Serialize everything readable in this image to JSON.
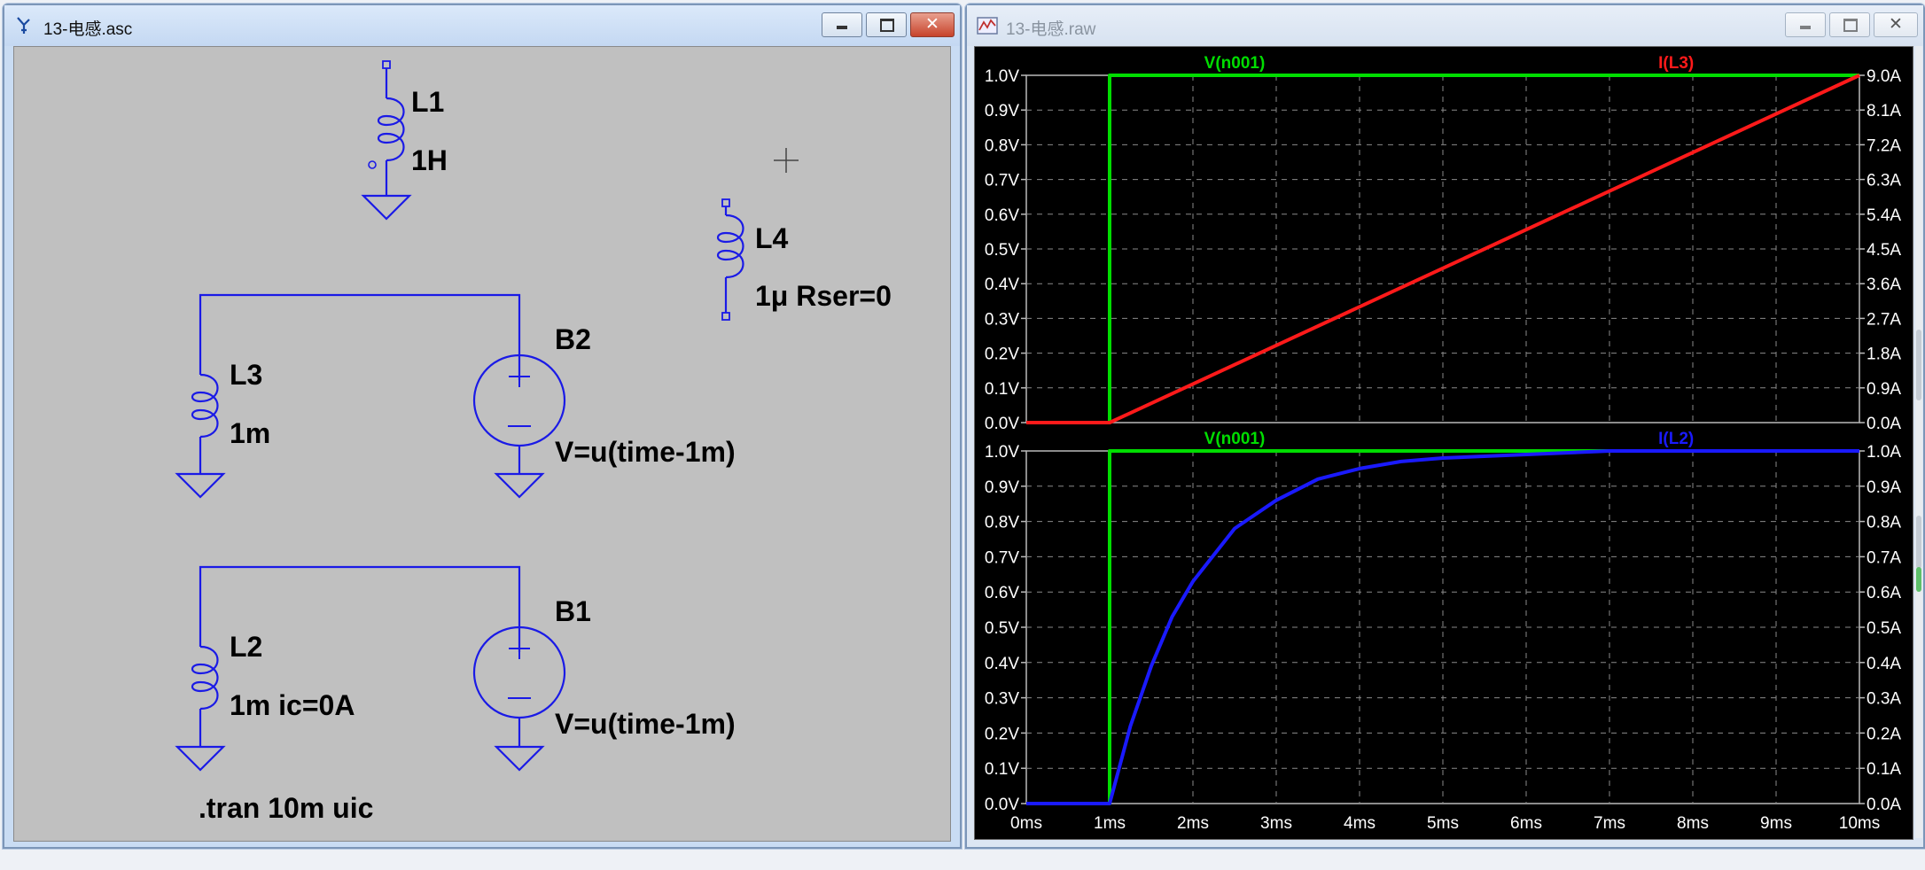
{
  "schematic_window": {
    "title": "13-电感.asc",
    "components": {
      "L1": {
        "name": "L1",
        "value": "1H"
      },
      "L4": {
        "name": "L4",
        "value": "1μ Rser=0"
      },
      "L3": {
        "name": "L3",
        "value": "1m"
      },
      "B2": {
        "name": "B2",
        "expr": "V=u(time-1m)"
      },
      "L2": {
        "name": "L2",
        "value": "1m ic=0A"
      },
      "B1": {
        "name": "B1",
        "expr": "V=u(time-1m)"
      }
    },
    "directive": ".tran 10m uic"
  },
  "waveform_window": {
    "title": "13-电感.raw"
  },
  "colors": {
    "wire": "#1a1ae6",
    "component": "#1a1ae6",
    "text": "#000000",
    "trace_voltage": "#00dd00",
    "trace_il3": "#ff1a1a",
    "trace_il2": "#1a1aff",
    "plot_bg": "#000000",
    "plot_text": "#ffffff"
  },
  "chart_data": [
    {
      "type": "line",
      "title": "",
      "x_tick_labels": [
        "0ms",
        "1ms",
        "2ms",
        "3ms",
        "4ms",
        "5ms",
        "6ms",
        "7ms",
        "8ms",
        "9ms",
        "10ms"
      ],
      "xlim": [
        0,
        10
      ],
      "y_left_ticks": [
        "0.0V",
        "0.1V",
        "0.2V",
        "0.3V",
        "0.4V",
        "0.5V",
        "0.6V",
        "0.7V",
        "0.8V",
        "0.9V",
        "1.0V"
      ],
      "y_left_lim": [
        0,
        1
      ],
      "y_right_ticks": [
        "0.0A",
        "0.9A",
        "1.8A",
        "2.7A",
        "3.6A",
        "4.5A",
        "5.4A",
        "6.3A",
        "7.2A",
        "8.1A",
        "9.0A"
      ],
      "y_right_lim": [
        0,
        9
      ],
      "grid": true,
      "series": [
        {
          "name": "V(n001)",
          "axis": "left",
          "color": "#00dd00",
          "x": [
            0,
            1,
            1,
            10
          ],
          "y": [
            0,
            0,
            1,
            1
          ]
        },
        {
          "name": "I(L3)",
          "axis": "right",
          "color": "#ff1a1a",
          "x": [
            0,
            1,
            10
          ],
          "y": [
            0,
            0,
            9
          ]
        }
      ]
    },
    {
      "type": "line",
      "title": "",
      "x_tick_labels": [
        "0ms",
        "1ms",
        "2ms",
        "3ms",
        "4ms",
        "5ms",
        "6ms",
        "7ms",
        "8ms",
        "9ms",
        "10ms"
      ],
      "xlim": [
        0,
        10
      ],
      "y_left_ticks": [
        "0.0V",
        "0.1V",
        "0.2V",
        "0.3V",
        "0.4V",
        "0.5V",
        "0.6V",
        "0.7V",
        "0.8V",
        "0.9V",
        "1.0V"
      ],
      "y_left_lim": [
        0,
        1
      ],
      "y_right_ticks": [
        "0.0A",
        "0.1A",
        "0.2A",
        "0.3A",
        "0.4A",
        "0.5A",
        "0.6A",
        "0.7A",
        "0.8A",
        "0.9A",
        "1.0A"
      ],
      "y_right_lim": [
        0,
        1
      ],
      "grid": true,
      "series": [
        {
          "name": "V(n001)",
          "axis": "left",
          "color": "#00dd00",
          "x": [
            0,
            1,
            1,
            10
          ],
          "y": [
            0,
            0,
            1,
            1
          ]
        },
        {
          "name": "I(L2)",
          "axis": "right",
          "color": "#1a1aff",
          "x": [
            0,
            1,
            1.25,
            1.5,
            1.75,
            2,
            2.5,
            3,
            3.5,
            4,
            4.5,
            5,
            6,
            7,
            8,
            9,
            10
          ],
          "y": [
            0,
            0,
            0.22,
            0.39,
            0.53,
            0.63,
            0.78,
            0.86,
            0.92,
            0.95,
            0.97,
            0.98,
            0.99,
            1.0,
            1.0,
            1.0,
            1.0
          ]
        }
      ]
    }
  ]
}
